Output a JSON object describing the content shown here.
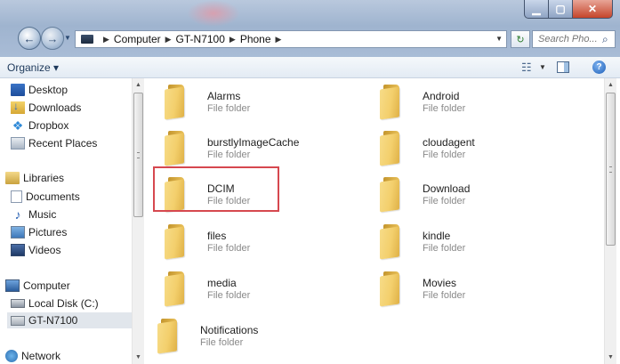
{
  "address": {
    "crumbs": [
      "Computer",
      "GT-N7100",
      "Phone"
    ],
    "search_placeholder": "Search Pho..."
  },
  "toolbar": {
    "organize_label": "Organize ▾"
  },
  "nav": {
    "favorites": [
      {
        "label": "Desktop",
        "icon": "desktop-icon"
      },
      {
        "label": "Downloads",
        "icon": "downloads-icon"
      },
      {
        "label": "Dropbox",
        "icon": "dropbox-icon"
      },
      {
        "label": "Recent Places",
        "icon": "recent-places-icon"
      }
    ],
    "libraries": {
      "label": "Libraries",
      "items": [
        {
          "label": "Documents",
          "icon": "documents-icon"
        },
        {
          "label": "Music",
          "icon": "music-icon"
        },
        {
          "label": "Pictures",
          "icon": "pictures-icon"
        },
        {
          "label": "Videos",
          "icon": "videos-icon"
        }
      ]
    },
    "computer": {
      "label": "Computer",
      "items": [
        {
          "label": "Local Disk (C:)",
          "icon": "local-disk-icon"
        },
        {
          "label": "GT-N7100",
          "icon": "device-icon",
          "selected": true
        }
      ]
    },
    "network": {
      "label": "Network"
    }
  },
  "folders": [
    {
      "name": "Alarms",
      "type": "File folder"
    },
    {
      "name": "Android",
      "type": "File folder"
    },
    {
      "name": "burstlyImageCache",
      "type": "File folder"
    },
    {
      "name": "cloudagent",
      "type": "File folder"
    },
    {
      "name": "DCIM",
      "type": "File folder",
      "highlighted": true
    },
    {
      "name": "Download",
      "type": "File folder"
    },
    {
      "name": "files",
      "type": "File folder"
    },
    {
      "name": "kindle",
      "type": "File folder"
    },
    {
      "name": "media",
      "type": "File folder"
    },
    {
      "name": "Movies",
      "type": "File folder"
    },
    {
      "name": "Notifications",
      "type": "File folder"
    }
  ],
  "colors": {
    "highlight_border": "#d6484f",
    "title_bar": "#a9bcd6"
  }
}
